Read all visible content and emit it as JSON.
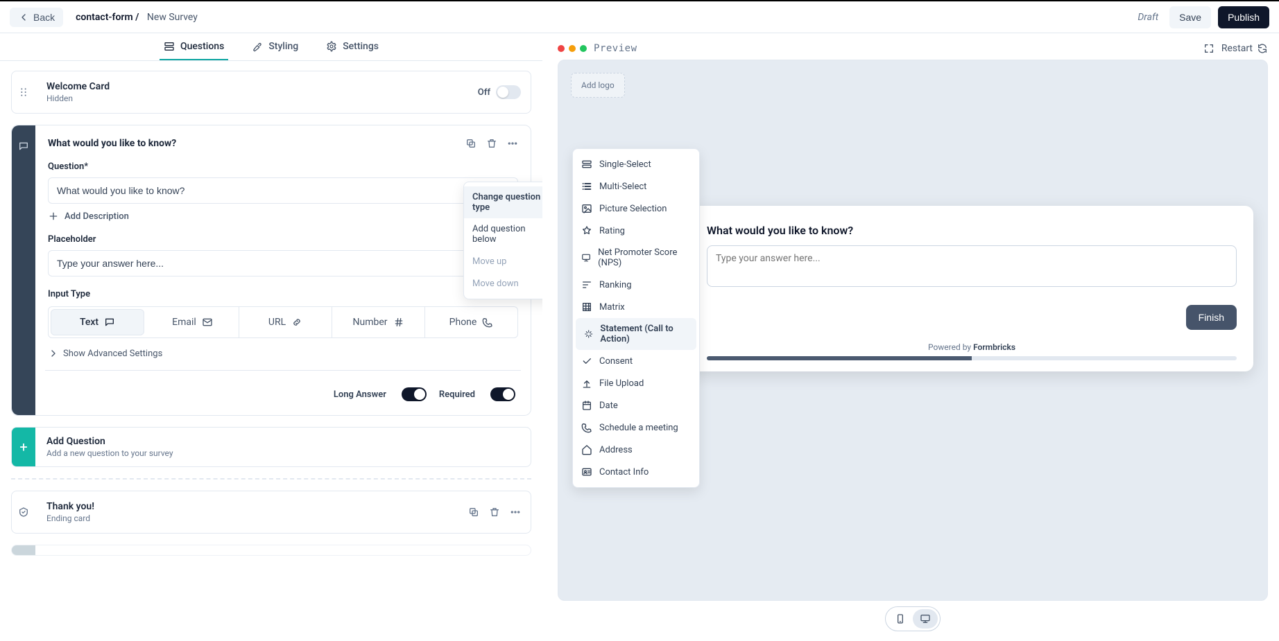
{
  "header": {
    "back": "Back",
    "project": "contact-form /",
    "page": "New Survey",
    "status": "Draft",
    "save": "Save",
    "publish": "Publish"
  },
  "tabs": {
    "questions": "Questions",
    "styling": "Styling",
    "settings": "Settings"
  },
  "welcome": {
    "title": "Welcome Card",
    "sub": "Hidden",
    "toggle_label": "Off"
  },
  "question": {
    "headline": "What would you like to know?",
    "label_question": "Question*",
    "value_question": "What would you like to know?",
    "add_description": "Add Description",
    "label_placeholder": "Placeholder",
    "value_placeholder": "Type your answer here...",
    "label_input_type": "Input Type",
    "input_types": {
      "text": "Text",
      "email": "Email",
      "url": "URL",
      "number": "Number",
      "phone": "Phone"
    },
    "advanced": "Show Advanced Settings",
    "long_answer": "Long Answer",
    "required": "Required"
  },
  "add_question": {
    "title": "Add Question",
    "sub": "Add a new question to your survey"
  },
  "thankyou": {
    "title": "Thank you!",
    "sub": "Ending card"
  },
  "context_menu": {
    "change_type": "Change question type",
    "add_below": "Add question below",
    "move_up": "Move up",
    "move_down": "Move down"
  },
  "question_types": {
    "single": "Single-Select",
    "multi": "Multi-Select",
    "picture": "Picture Selection",
    "rating": "Rating",
    "nps": "Net Promoter Score (NPS)",
    "ranking": "Ranking",
    "matrix": "Matrix",
    "statement": "Statement (Call to Action)",
    "consent": "Consent",
    "file": "File Upload",
    "date": "Date",
    "schedule": "Schedule a meeting",
    "address": "Address",
    "contact": "Contact Info"
  },
  "preview": {
    "title": "Preview",
    "restart": "Restart",
    "add_logo": "Add logo",
    "survey_question": "What would you like to know?",
    "survey_placeholder": "Type your answer here...",
    "finish": "Finish",
    "powered_prefix": "Powered by ",
    "powered_brand": "Formbricks"
  }
}
